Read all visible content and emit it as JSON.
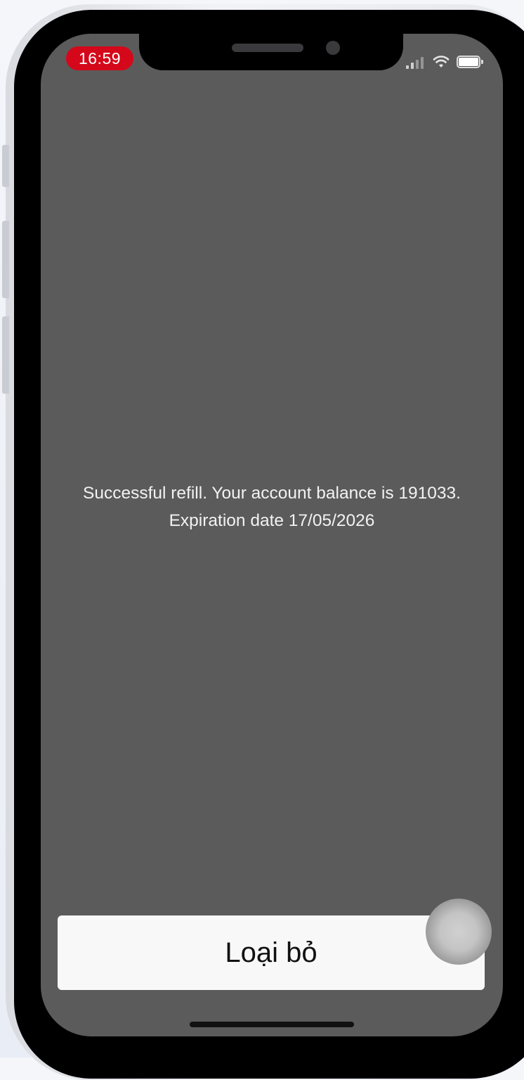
{
  "status_bar": {
    "time": "16:59",
    "time_pill_color": "#d4081a",
    "icons": [
      "signal-icon",
      "wifi-icon",
      "battery-icon"
    ]
  },
  "alert": {
    "message_line1": "Successful refill. Your account balance is 191033.",
    "message_line2": "Expiration date 17/05/2026",
    "dismiss_label": "Loại bỏ"
  },
  "colors": {
    "screen_background": "#5b5b5b",
    "button_background": "#f8f8f8"
  }
}
